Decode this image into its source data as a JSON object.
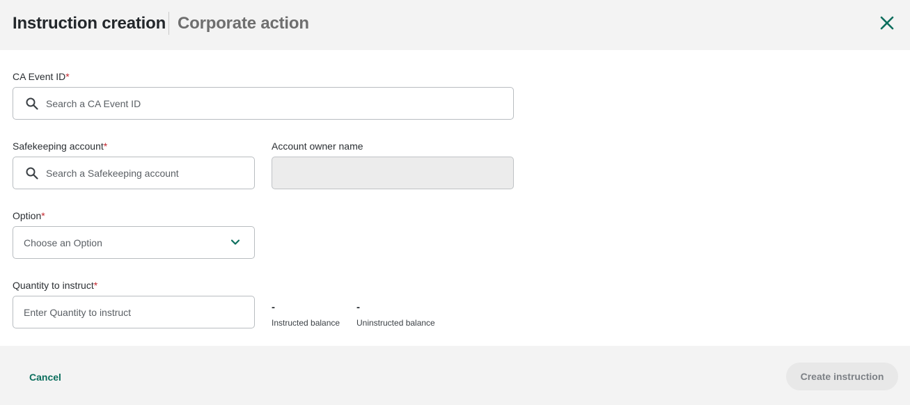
{
  "header": {
    "title": "Instruction creation",
    "subtitle": "Corporate action",
    "close_icon": "close-icon"
  },
  "form": {
    "ca_event_id": {
      "label": "CA Event ID",
      "required_marker": "*",
      "placeholder": "Search a CA Event ID",
      "value": ""
    },
    "safekeeping_account": {
      "label": "Safekeeping account",
      "required_marker": "*",
      "placeholder": "Search a Safekeeping account",
      "value": ""
    },
    "account_owner_name": {
      "label": "Account owner name",
      "value": ""
    },
    "option": {
      "label": "Option",
      "required_marker": "*",
      "placeholder": "Choose an Option",
      "selected": ""
    },
    "quantity": {
      "label": "Quantity to instruct",
      "required_marker": "*",
      "placeholder": "Enter Quantity to instruct",
      "value": ""
    },
    "instructed_balance": {
      "value": "-",
      "label": "Instructed balance"
    },
    "uninstructed_balance": {
      "value": "-",
      "label": "Uninstructed balance"
    }
  },
  "footer": {
    "cancel_label": "Cancel",
    "create_label": "Create instruction"
  },
  "colors": {
    "accent": "#0b6e5d",
    "required": "#c4262e",
    "header_bg": "#f3f3f3",
    "disabled_button_bg": "#e8e8e8"
  }
}
